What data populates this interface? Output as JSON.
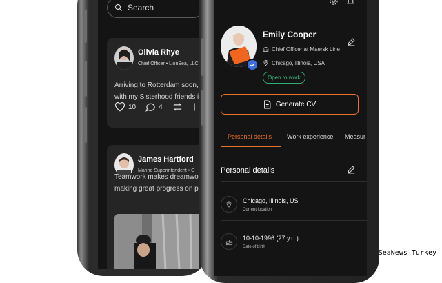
{
  "feed": {
    "search": {
      "placeholder": "Search"
    },
    "posts": [
      {
        "name": "Olivia Rhye",
        "role": "Chief Officer • LionSea, LLC",
        "text": [
          "Arriving to Rotterdam soon, c",
          "with my Sisterhood friends in"
        ],
        "likes": "10",
        "comments": "4"
      },
      {
        "name": "James Hartford",
        "role": "Marine Superintendent • C",
        "text": [
          "Teamwork makes dreamwo",
          "making great progress on p"
        ]
      }
    ]
  },
  "profile": {
    "name": "Emily Cooper",
    "position": "Chief Officer at Maersk Line",
    "location": "Chicago, Illinois, USA",
    "status": "Open to work",
    "generate_cv": "Generate CV",
    "tabs": [
      "Personal details",
      "Work experience",
      "Measur"
    ],
    "section_title": "Personal details",
    "details": [
      {
        "value": "Chicago, Illinois, US",
        "label": "Current location"
      },
      {
        "value": "10-10-1996 (27 y.o.)",
        "label": "Date of birth"
      }
    ]
  },
  "watermark": "SeaNews Turkey",
  "colors": {
    "accent": "#e8702a",
    "success": "#37c583",
    "verified": "#3b6fe0"
  }
}
